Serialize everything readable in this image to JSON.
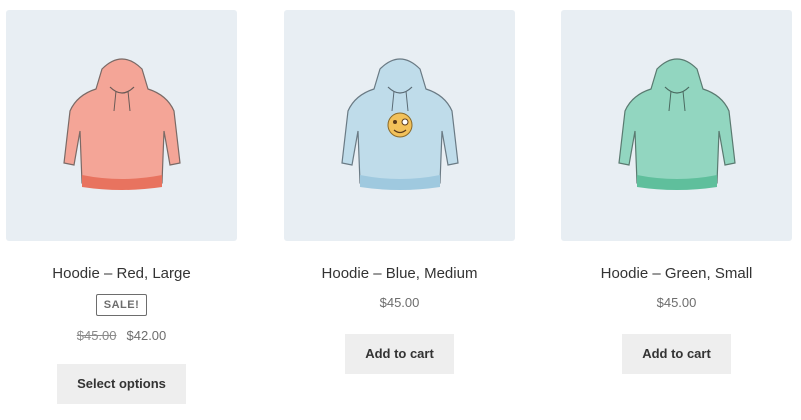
{
  "products": [
    {
      "title": "Hoodie – Red, Large",
      "badge": "SALE!",
      "old_price": "$45.00",
      "price": "$42.00",
      "button": "Select options",
      "color": "#f4a597",
      "band": "#e8735f"
    },
    {
      "title": "Hoodie – Blue, Medium",
      "price": "$45.00",
      "button": "Add to cart",
      "color": "#bfdcea",
      "band": "#9fc9df"
    },
    {
      "title": "Hoodie – Green, Small",
      "price": "$45.00",
      "button": "Add to cart",
      "color": "#92d6c0",
      "band": "#5fbf9c"
    }
  ]
}
